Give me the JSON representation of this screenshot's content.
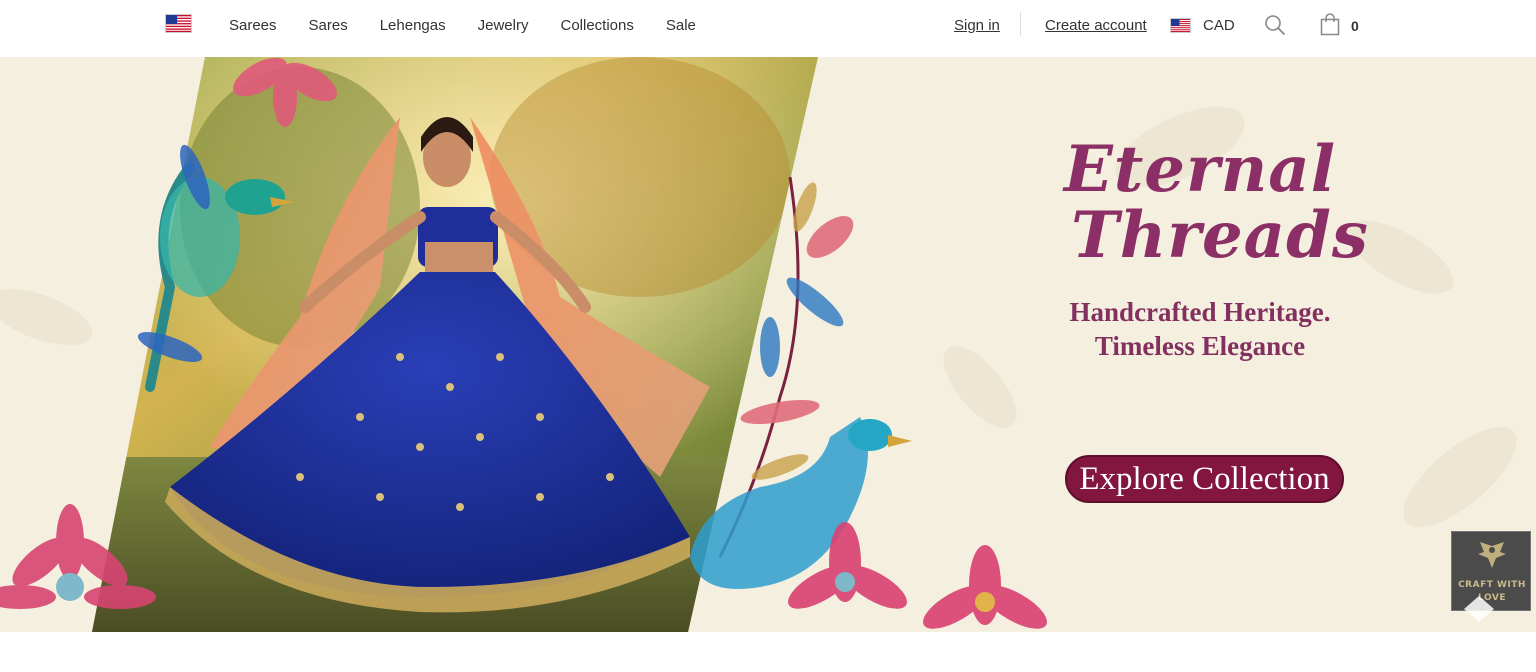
{
  "header": {
    "nav": [
      "Sarees",
      "Sares",
      "Lehengas",
      "Jewelry",
      "Collections",
      "Sale"
    ],
    "sign_in": "Sign in",
    "create_account": "Create account",
    "currency": "CAD",
    "cart_count": "0"
  },
  "icons": {
    "flag": "us-flag-icon",
    "search": "search-icon",
    "cart": "shopping-bag-icon",
    "badge": "eagle-logo-icon",
    "scroll": "chevron-up-icon"
  },
  "hero": {
    "title_line1": "Eternal",
    "title_line2": "Threads",
    "tagline_line1": "Handcrafted Heritage.",
    "tagline_line2": "Timeless Elegance",
    "cta": "Explore Collection"
  },
  "badge": {
    "line1": "CRAFT WITH",
    "line2": "LOVE"
  },
  "colors": {
    "accent": "#82163f",
    "title": "#8c2f66",
    "hero_bg": "#f4efe0"
  }
}
